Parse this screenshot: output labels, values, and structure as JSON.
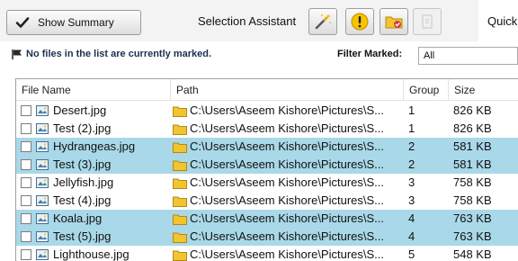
{
  "toolbar": {
    "show_summary_label": "Show Summary",
    "selection_assistant_label": "Selection Assistant",
    "quick_label": "Quick",
    "buttons": [
      "magic-wand-icon",
      "warning-icon",
      "folder-mark-icon",
      "disabled-page-icon"
    ]
  },
  "status": {
    "message": "No files in the list are currently marked.",
    "filter_label": "Filter Marked:",
    "filter_value": "All"
  },
  "table": {
    "columns": [
      "File Name",
      "Path",
      "Group",
      "Size"
    ],
    "rows": [
      {
        "name": "Desert.jpg",
        "path": "C:\\Users\\Aseem Kishore\\Pictures\\S...",
        "group": "1",
        "size": "826 KB",
        "selected": false
      },
      {
        "name": "Test (2).jpg",
        "path": "C:\\Users\\Aseem Kishore\\Pictures\\S...",
        "group": "1",
        "size": "826 KB",
        "selected": false
      },
      {
        "name": "Hydrangeas.jpg",
        "path": "C:\\Users\\Aseem Kishore\\Pictures\\S...",
        "group": "2",
        "size": "581 KB",
        "selected": true
      },
      {
        "name": "Test (3).jpg",
        "path": "C:\\Users\\Aseem Kishore\\Pictures\\S...",
        "group": "2",
        "size": "581 KB",
        "selected": true
      },
      {
        "name": "Jellyfish.jpg",
        "path": "C:\\Users\\Aseem Kishore\\Pictures\\S...",
        "group": "3",
        "size": "758 KB",
        "selected": false
      },
      {
        "name": "Test (4).jpg",
        "path": "C:\\Users\\Aseem Kishore\\Pictures\\S...",
        "group": "3",
        "size": "758 KB",
        "selected": false
      },
      {
        "name": "Koala.jpg",
        "path": "C:\\Users\\Aseem Kishore\\Pictures\\S...",
        "group": "4",
        "size": "763 KB",
        "selected": true
      },
      {
        "name": "Test (5).jpg",
        "path": "C:\\Users\\Aseem Kishore\\Pictures\\S...",
        "group": "4",
        "size": "763 KB",
        "selected": true
      },
      {
        "name": "Lighthouse.jpg",
        "path": "C:\\Users\\Aseem Kishore\\Pictures\\S...",
        "group": "5",
        "size": "548 KB",
        "selected": false
      }
    ]
  },
  "colors": {
    "selected_row": "#a9d8e8",
    "status_text": "#1c2f52",
    "folder": "#f2c530"
  }
}
